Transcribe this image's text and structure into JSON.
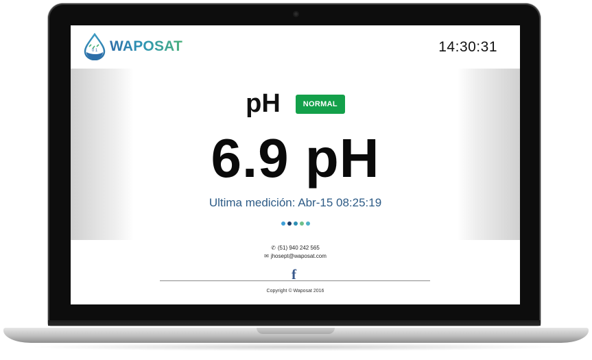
{
  "header": {
    "brand": "WAPOSAT",
    "clock": "14:30:31",
    "brand_colors": [
      "#2f6ea8",
      "#2e95b5",
      "#49b07a"
    ]
  },
  "measurement": {
    "parameter": "pH",
    "status": "NORMAL",
    "status_color": "#13a04a",
    "value_display": "6.9 pH",
    "last_measure": "Ultima medición: Abr-15 08:25:19"
  },
  "carousel": {
    "dot_colors": [
      "#3fa0d8",
      "#1f3f6a",
      "#2e8fb4",
      "#6fbf8a",
      "#4fb0c8"
    ]
  },
  "footer": {
    "phone": "(51) 940 242 565",
    "email": "jhosept@waposat.com",
    "facebook_icon": "f",
    "copyright": "Copyright © Waposat 2016"
  }
}
